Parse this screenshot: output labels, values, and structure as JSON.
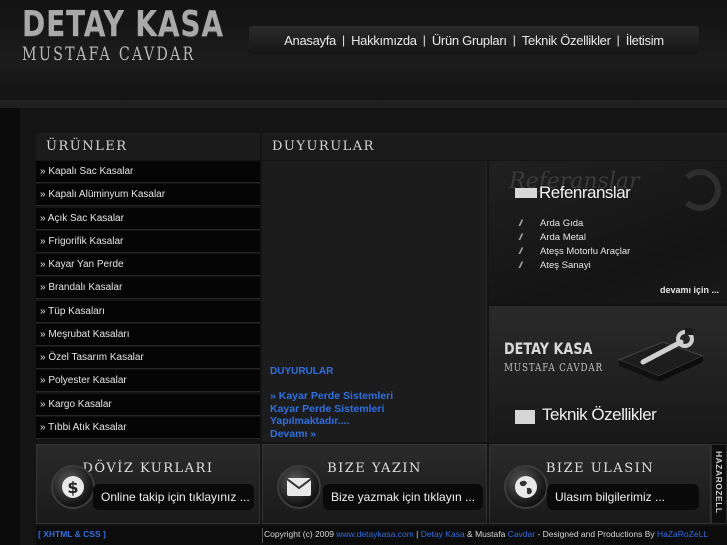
{
  "brand": {
    "title": "DETAY KASA",
    "subtitle": "MUSTAFA CAVDAR"
  },
  "nav": {
    "items": [
      "Anasayfa",
      "Hakkımızda",
      "Ürün Grupları",
      "Teknik Özellikler",
      "İletisim"
    ],
    "separator": "|"
  },
  "products": {
    "heading": "ÜRÜNLER",
    "items": [
      "» Kapalı Sac Kasalar",
      "» Kapalı Alüminyum Kasalar",
      "» Açık Sac Kasalar",
      "» Frigorifik Kasalar",
      "» Kayar Yan Perde",
      "» Brandalı Kasalar",
      "» Tüp Kasaları",
      "» Meşrubat Kasaları",
      "» Özel Tasarım Kasalar",
      "» Polyester Kasalar",
      "» Kargo Kasalar",
      "» Tıbbi Atık Kasalar"
    ]
  },
  "announcements": {
    "heading": "DUYURULAR",
    "title": "DUYURULAR",
    "lines": [
      "» Kayar Perde Sistemleri",
      "Kayar Perde Sistemleri",
      "Yapılmaktadır....",
      "Devamı »"
    ]
  },
  "references": {
    "watermark": "Referanslar",
    "title": "Refenranslar",
    "items": [
      "Arda Gıda",
      "Arda Metal",
      "Ateşs Motorlu Araçlar",
      "Ateş Sanayi"
    ],
    "marker": "///",
    "more": "devamı için ..."
  },
  "tech": {
    "brand": "DETAY KASA",
    "brand_sub": "MUSTAFA CAVDAR",
    "title": "Teknik Özellikler"
  },
  "panels": {
    "doviz": {
      "title": "DÖVİZ KURLARI",
      "text": "Online takip için tıklayınız ...",
      "icon": "dollar-icon"
    },
    "yazin": {
      "title": "BIZE YAZIN",
      "text": "Bize yazmak için tıklayın ...",
      "icon": "envelope-icon"
    },
    "ulasin": {
      "title": "BIZE ULASIN",
      "text": "Ulasım bilgilerimiz ...",
      "icon": "globe-icon"
    }
  },
  "signature": "HAZAROZELL",
  "footer": {
    "xhtml": "[ XHTML & CSS ]",
    "copy_prefix": "Copyright (c) 2009 ",
    "site": "www.detaykasa.com",
    "sep1": " | ",
    "detay": "Detay",
    "kasa": " Kasa",
    "amp": " & Mustafa ",
    "cavdar": "Cavdar",
    "designed": " - Designed and Productions By ",
    "author": "HaZaRoZeLL"
  },
  "colors": {
    "accent_blue": "#2f6fe0",
    "background": "#0b0b0b",
    "panel": "#1c1c1c"
  }
}
